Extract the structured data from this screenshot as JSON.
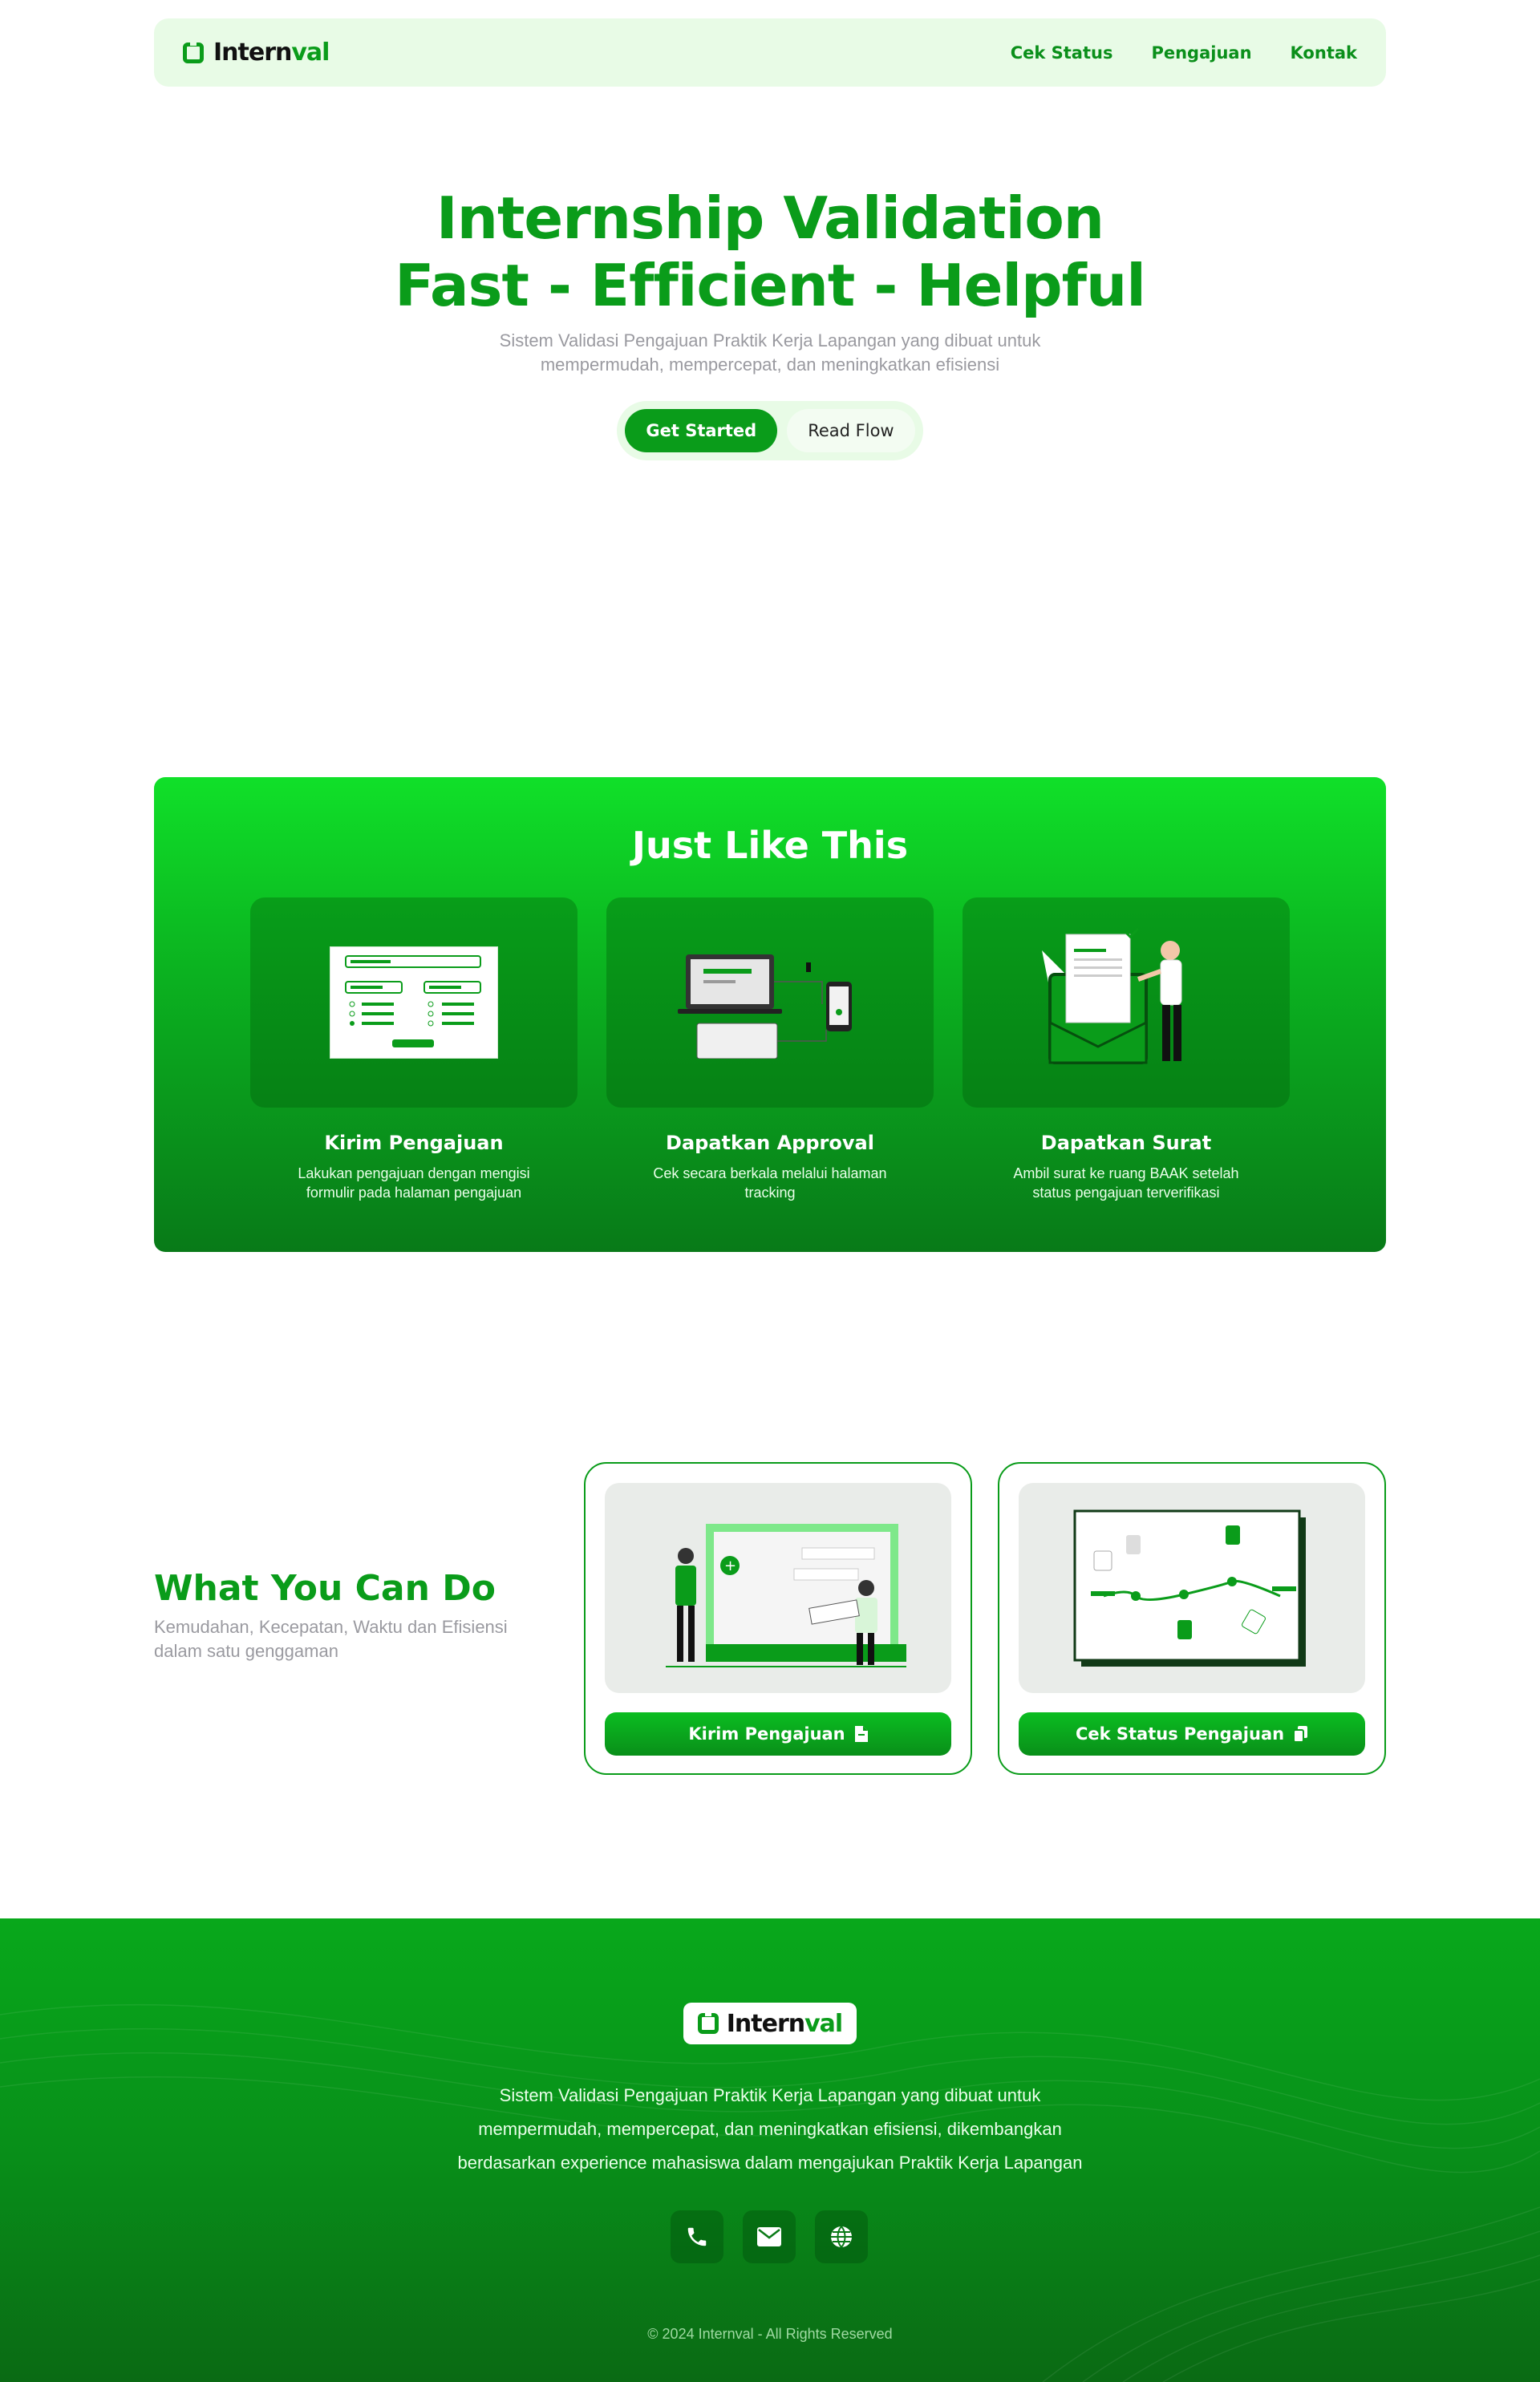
{
  "brand": {
    "name_prefix": "Intern",
    "name_suffix": "val"
  },
  "nav": {
    "items": [
      "Cek Status",
      "Pengajuan",
      "Kontak"
    ]
  },
  "hero": {
    "title_line1": "Internship Validation",
    "title_line2": "Fast - Efficient - Helpful",
    "subtitle_line1": "Sistem Validasi Pengajuan Praktik Kerja Lapangan yang dibuat untuk",
    "subtitle_line2": "mempermudah, mempercepat, dan meningkatkan efisiensi",
    "primary_cta": "Get Started",
    "secondary_cta": "Read Flow"
  },
  "flow": {
    "title": "Just Like This",
    "steps": [
      {
        "title": "Kirim Pengajuan",
        "desc": "Lakukan pengajuan dengan mengisi formulir pada halaman pengajuan",
        "icon": "form-illustration"
      },
      {
        "title": "Dapatkan Approval",
        "desc": "Cek secara berkala melalui halaman tracking",
        "icon": "devices-illustration"
      },
      {
        "title": "Dapatkan Surat",
        "desc": "Ambil surat ke ruang BAAK setelah status pengajuan terverifikasi",
        "icon": "letter-illustration"
      }
    ]
  },
  "actions": {
    "title": "What You Can Do",
    "subtitle_line1": "Kemudahan, Kecepatan, Waktu dan Efisiensi",
    "subtitle_line2": "dalam satu genggaman",
    "cards": [
      {
        "button": "Kirim Pengajuan",
        "icon": "file-icon"
      },
      {
        "button": "Cek Status Pengajuan",
        "icon": "copy-icon"
      }
    ]
  },
  "footer": {
    "desc_line1": "Sistem Validasi Pengajuan Praktik Kerja Lapangan yang dibuat untuk",
    "desc_line2": "mempermudah, mempercepat, dan meningkatkan efisiensi, dikembangkan",
    "desc_line3": "berdasarkan experience mahasiswa dalam mengajukan Praktik Kerja Lapangan",
    "icons": [
      "phone-icon",
      "mail-icon",
      "globe-icon"
    ],
    "copyright": "© 2024 Internval - All Rights Reserved"
  },
  "colors": {
    "primary": "#0a9c1a",
    "nav_bg": "#e8fbe6",
    "muted": "#9a9aa0"
  }
}
